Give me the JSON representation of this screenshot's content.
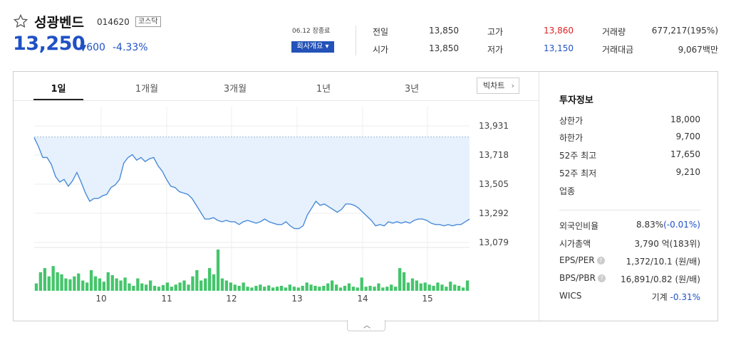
{
  "stock": {
    "name": "성광벤드",
    "code": "014620",
    "market": "코스닥",
    "price": "13,250",
    "change": "600",
    "rate": "-4.33%",
    "date": "06.12 장종료",
    "company_btn": "회사개요 ▾"
  },
  "quotes": {
    "prev_label": "전일",
    "prev": "13,850",
    "high_label": "고가",
    "high": "13,860",
    "volume_label": "거래량",
    "volume": "677,217(195%)",
    "open_label": "시가",
    "open": "13,850",
    "low_label": "저가",
    "low": "13,150",
    "amount_label": "거래대금",
    "amount": "9,067백만"
  },
  "tabs": [
    "1일",
    "1개월",
    "3개월",
    "1년",
    "3년"
  ],
  "big_chart": "빅차트",
  "invest": {
    "title": "투자정보",
    "rows1": [
      {
        "label": "상한가",
        "value": "18,000",
        "color": "#e02020"
      },
      {
        "label": "하한가",
        "value": "9,700",
        "color": "#1f51c4"
      },
      {
        "label": "52주 최고",
        "value": "17,650",
        "color": "#333333"
      },
      {
        "label": "52주 최저",
        "value": "9,210",
        "color": "#333333"
      },
      {
        "label": "업종",
        "value": "",
        "color": "#333333"
      }
    ],
    "foreign_label": "외국인비율",
    "foreign_val": "8.83%",
    "foreign_chg": "(-0.01%)",
    "mcap_label": "시가총액",
    "mcap_val": "3,790 억(183위)",
    "eps_label": "EPS/PER",
    "eps_val": "1,372/10.1 (원/배)",
    "bps_label": "BPS/PBR",
    "bps_val": "16,891/0.82 (원/배)",
    "wics_label": "WICS",
    "wics_val": "기계",
    "wics_chg": "-0.31%"
  },
  "chart_data": {
    "type": "line",
    "title": "",
    "xlabel": "",
    "ylabel": "",
    "yticks": [
      "13,931",
      "13,718",
      "13,505",
      "13,292",
      "13,079"
    ],
    "ytick_values": [
      13931,
      13718,
      13505,
      13292,
      13079
    ],
    "ylim": [
      13079,
      13931
    ],
    "xticks": [
      "10",
      "11",
      "12",
      "13",
      "14",
      "15"
    ],
    "reference_value": 13850,
    "series": [
      {
        "values": [
          13845,
          13780,
          13700,
          13700,
          13650,
          13560,
          13520,
          13540,
          13490,
          13530,
          13590,
          13520,
          13440,
          13380,
          13400,
          13400,
          13420,
          13430,
          13480,
          13500,
          13540,
          13660,
          13700,
          13720,
          13680,
          13700,
          13670,
          13690,
          13700,
          13640,
          13600,
          13540,
          13490,
          13480,
          13450,
          13440,
          13430,
          13400,
          13350,
          13300,
          13250,
          13250,
          13260,
          13240,
          13230,
          13240,
          13230,
          13230,
          13210,
          13230,
          13240,
          13230,
          13220,
          13230,
          13250,
          13230,
          13220,
          13210,
          13210,
          13230,
          13200,
          13180,
          13180,
          13200,
          13280,
          13330,
          13380,
          13350,
          13360,
          13340,
          13320,
          13300,
          13320,
          13360,
          13360,
          13350,
          13330,
          13300,
          13270,
          13240,
          13200,
          13210,
          13200,
          13230,
          13220,
          13230,
          13220,
          13230,
          13220,
          13240,
          13250,
          13250,
          13240,
          13220,
          13210,
          13210,
          13200,
          13210,
          13200,
          13210,
          13210,
          13230,
          13250
        ]
      }
    ],
    "volume": [
      0.18,
      0.45,
      0.55,
      0.35,
      0.6,
      0.45,
      0.4,
      0.3,
      0.28,
      0.35,
      0.42,
      0.25,
      0.2,
      0.5,
      0.35,
      0.3,
      0.22,
      0.45,
      0.38,
      0.3,
      0.25,
      0.32,
      0.18,
      0.12,
      0.3,
      0.18,
      0.15,
      0.25,
      0.12,
      0.1,
      0.14,
      0.2,
      0.1,
      0.15,
      0.2,
      0.25,
      0.15,
      0.35,
      0.5,
      0.25,
      0.3,
      0.55,
      0.4,
      1.0,
      0.3,
      0.25,
      0.2,
      0.15,
      0.12,
      0.2,
      0.1,
      0.08,
      0.12,
      0.15,
      0.1,
      0.13,
      0.08,
      0.1,
      0.12,
      0.08,
      0.15,
      0.1,
      0.08,
      0.12,
      0.2,
      0.15,
      0.12,
      0.1,
      0.12,
      0.18,
      0.25,
      0.15,
      0.08,
      0.12,
      0.18,
      0.1,
      0.08,
      0.32,
      0.1,
      0.12,
      0.1,
      0.18,
      0.08,
      0.1,
      0.15,
      0.1,
      0.55,
      0.45,
      0.2,
      0.3,
      0.25,
      0.18,
      0.2,
      0.15,
      0.12,
      0.2,
      0.15,
      0.1,
      0.22,
      0.15,
      0.12,
      0.08,
      0.25
    ],
    "area_color": "#e6f1fd",
    "line_color": "#4a8ad8",
    "volume_color": "#44c56b",
    "grid": true
  }
}
